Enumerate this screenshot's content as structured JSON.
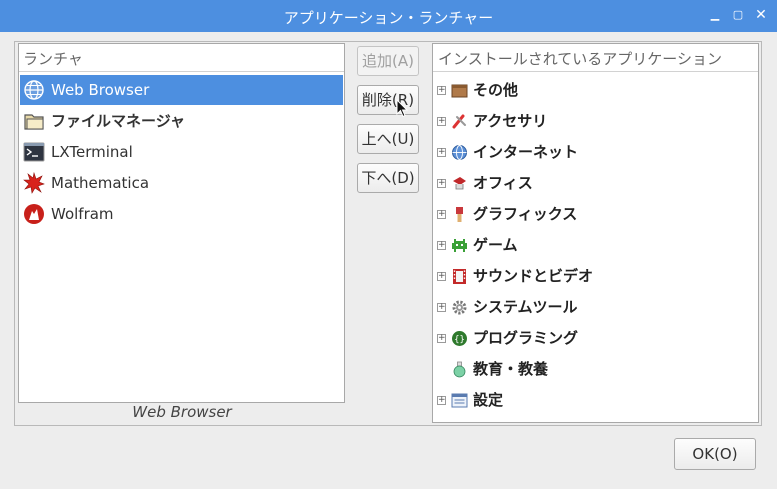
{
  "window": {
    "title": "アプリケーション・ランチャー"
  },
  "launcher": {
    "header": "ランチャ",
    "items": [
      {
        "label": "Web Browser",
        "icon": "globe-icon",
        "selected": true
      },
      {
        "label": "ファイルマネージャ",
        "icon": "folder-icon",
        "selected": false
      },
      {
        "label": "LXTerminal",
        "icon": "terminal-icon",
        "selected": false
      },
      {
        "label": "Mathematica",
        "icon": "mathematica-icon",
        "selected": false
      },
      {
        "label": "Wolfram",
        "icon": "wolfram-icon",
        "selected": false
      }
    ],
    "selected_caption": "Web Browser"
  },
  "buttons": {
    "add": "追加(A)",
    "remove": "削除(R)",
    "up": "上へ(U)",
    "down": "下へ(D)",
    "ok": "OK(O)"
  },
  "installed": {
    "header": "インストールされているアプリケーション",
    "categories": [
      {
        "label": "その他",
        "icon": "box-icon",
        "expandable": true
      },
      {
        "label": "アクセサリ",
        "icon": "accessories-icon",
        "expandable": true
      },
      {
        "label": "インターネット",
        "icon": "globe-icon",
        "expandable": true
      },
      {
        "label": "オフィス",
        "icon": "office-icon",
        "expandable": true
      },
      {
        "label": "グラフィックス",
        "icon": "brush-icon",
        "expandable": true
      },
      {
        "label": "ゲーム",
        "icon": "game-icon",
        "expandable": true
      },
      {
        "label": "サウンドとビデオ",
        "icon": "film-icon",
        "expandable": true
      },
      {
        "label": "システムツール",
        "icon": "gear-icon",
        "expandable": true
      },
      {
        "label": "プログラミング",
        "icon": "programming-icon",
        "expandable": true
      },
      {
        "label": "教育・教養",
        "icon": "flask-icon",
        "expandable": false
      },
      {
        "label": "設定",
        "icon": "settings-icon",
        "expandable": true
      }
    ]
  },
  "colors": {
    "accent": "#4d8fe0",
    "selection": "#4d8fe0"
  }
}
